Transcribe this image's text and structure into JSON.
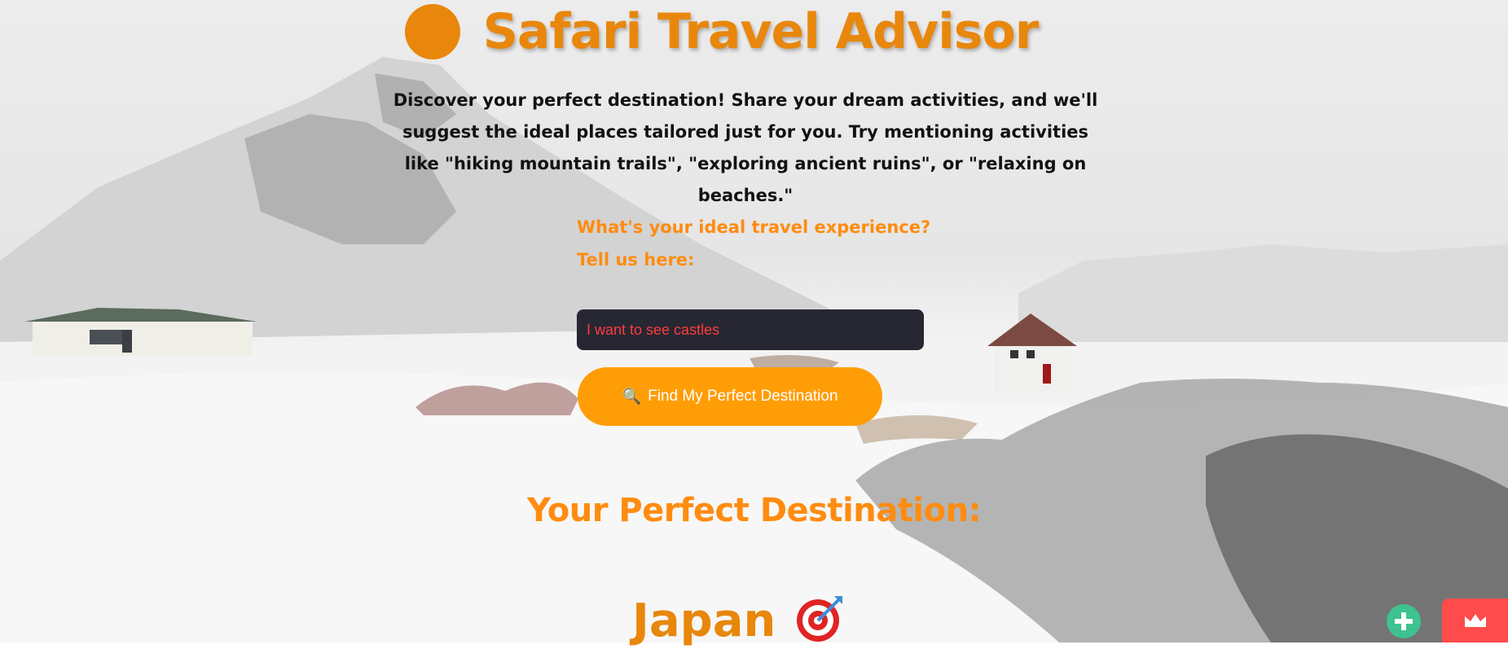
{
  "app": {
    "title": "Safari Travel Advisor",
    "intro": "Discover your perfect destination! Share your dream activities, and we'll suggest the ideal places tailored just for you. Try mentioning activities like \"hiking mountain trails\", \"exploring ancient ruins\", or \"relaxing on beaches.\""
  },
  "form": {
    "question": "What's your ideal travel experience?",
    "tell_us": "Tell us here:",
    "input_value": "I want to see castles",
    "button_icon": "🔍",
    "button_label": "Find My Perfect Destination"
  },
  "result": {
    "heading": "Your Perfect Destination:",
    "destination": "Japan",
    "destination_icon": "target-icon"
  },
  "colors": {
    "accent": "#ff8c10",
    "title": "#e8870c",
    "button": "#ff9d06",
    "input_bg": "#272733",
    "input_text": "#ff3b3b"
  },
  "icons": [
    "logo-dot-icon",
    "magnifier-icon",
    "target-icon",
    "plus-icon",
    "crown-icon"
  ]
}
